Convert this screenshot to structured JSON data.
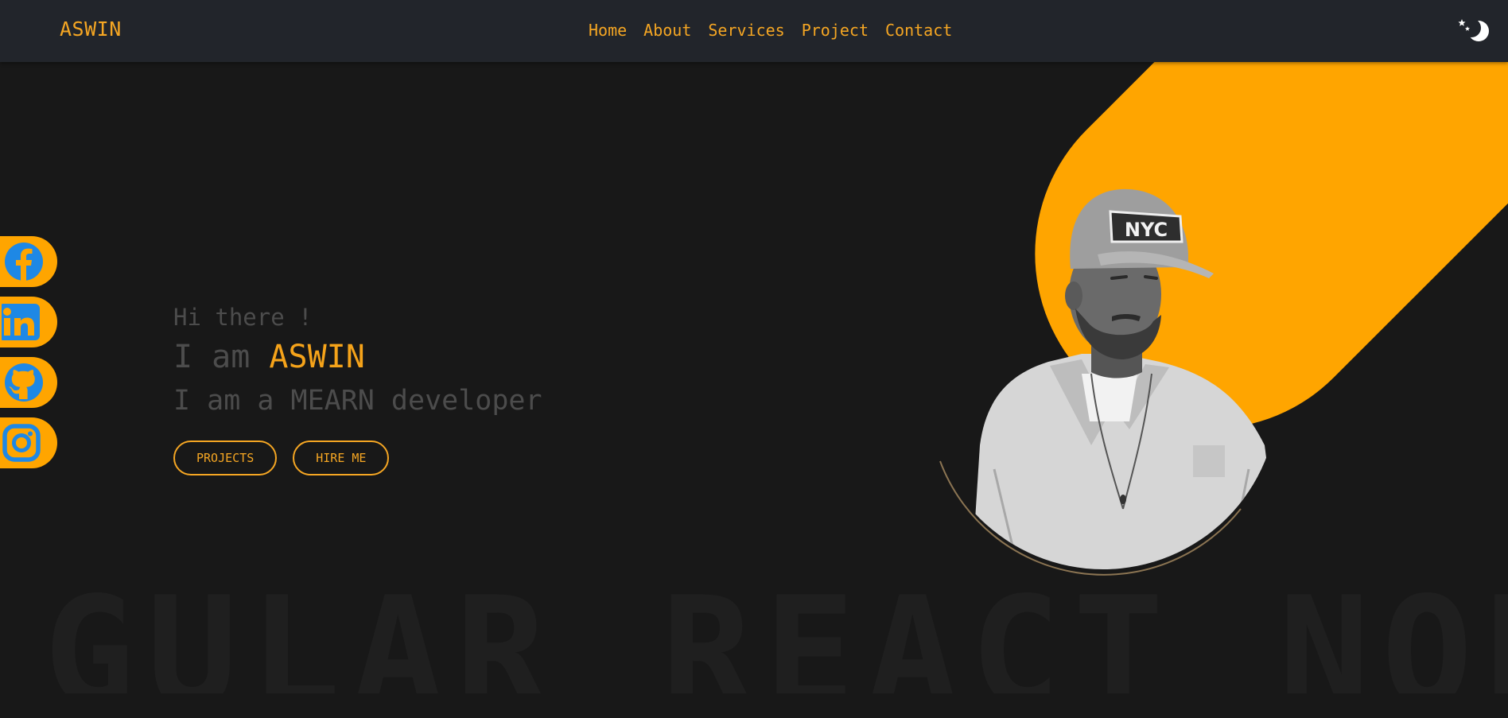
{
  "header": {
    "brand": "ASWIN",
    "nav": [
      "Home",
      "About",
      "Services",
      "Project",
      "Contact"
    ],
    "theme_toggle_icon": "moon-stars-icon"
  },
  "hero": {
    "greeting": "Hi there !",
    "intro_prefix": "I am ",
    "name": "ASWIN",
    "role": "I am a MEARN developer",
    "buttons": {
      "projects": "PROJECTS",
      "hire": "HIRE ME"
    },
    "portrait_cap_text": "NYC"
  },
  "socials": [
    {
      "name": "Facebook",
      "icon": "facebook-icon"
    },
    {
      "name": "LinkedIn",
      "icon": "linkedin-icon"
    },
    {
      "name": "GitHub",
      "icon": "github-icon"
    },
    {
      "name": "Instagram",
      "icon": "instagram-icon"
    }
  ],
  "background_text": "GULAR REACT NODE",
  "colors": {
    "accent": "#f5a623",
    "band": "#ffa500",
    "background": "#181818",
    "header": "#22252b",
    "muted_text": "#4c4c4c",
    "social_icon": "#1e88e5"
  }
}
